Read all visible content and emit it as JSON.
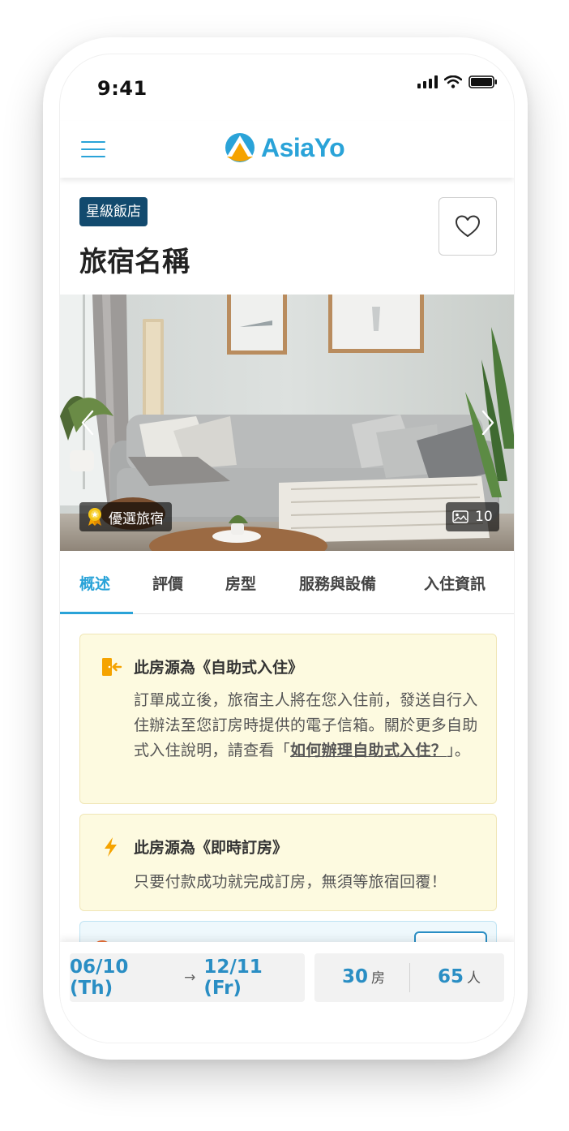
{
  "status_bar": {
    "time": "9:41"
  },
  "header": {
    "logo_text": "AsiaYo"
  },
  "hotel": {
    "badge": "星級飯店",
    "name": "旅宿名稱"
  },
  "photo": {
    "tag": "優選旅宿",
    "count": "10"
  },
  "tabs": [
    {
      "label": "概述",
      "active": true
    },
    {
      "label": "評價"
    },
    {
      "label": "房型"
    },
    {
      "label": "服務與設備"
    },
    {
      "label": "入住資訊"
    }
  ],
  "notices": {
    "self_checkin": {
      "title": "此房源為《自助式入住》",
      "body": "訂單成立後，旅宿主人將在您入住前，發送自行入住辦法至您訂房時提供的電子信箱。關於更多自助式入住說明，請查看「",
      "link": "如何辦理自助式入住？",
      "end": "」。"
    },
    "instant_booking": {
      "title": "此房源為《即時訂房》",
      "body": "只要付款成功就完成訂房，無須等旅宿回覆！"
    }
  },
  "booking_bar": {
    "check_in": "06/10 (Th)",
    "arrow": "→",
    "check_out": "12/11 (Fr)",
    "rooms_count": "30",
    "rooms_unit": "房",
    "people_count": "65",
    "people_unit": "人"
  },
  "colors": {
    "brand_blue": "#2aa3d8",
    "badge_navy": "#124a6e",
    "notice_yellow": "#fdfae0",
    "accent_orange": "#f5a300"
  }
}
